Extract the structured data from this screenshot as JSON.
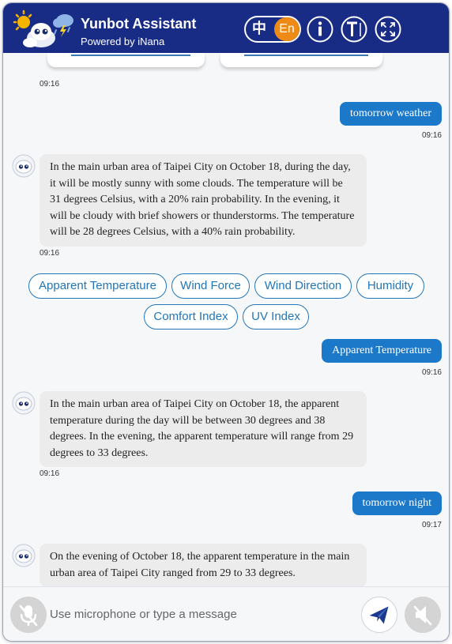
{
  "header": {
    "title": "Yunbot Assistant",
    "subtitle": "Powered by iNana",
    "lang_zh": "中",
    "lang_en": "En",
    "icons": [
      "info-icon",
      "text-size-icon",
      "fullscreen-icon"
    ]
  },
  "colors": {
    "header_bg": "#182c86",
    "accent": "#1c79c9",
    "lang_active": "#ee8a16",
    "bot_bubble": "#ececec"
  },
  "messages": [
    {
      "type": "bot",
      "time": "09:16"
    },
    {
      "type": "user",
      "text": "tomorrow weather",
      "time": "09:16"
    },
    {
      "type": "bot",
      "text": "In the main urban area of Taipei City on October 18, during the day, it will be mostly sunny with some clouds. The temperature will be 31 degrees Celsius, with a 20% rain probability. In the evening, it will be cloudy with brief showers or thunderstorms. The temperature will be 28 degrees Celsius, with a 40% rain probability.",
      "time": "09:16"
    },
    {
      "type": "user",
      "text": "Apparent Temperature",
      "time": "09:16"
    },
    {
      "type": "bot",
      "text": "In the main urban area of Taipei City on October 18, the apparent temperature during the day will be between 30 degrees and 38 degrees. In the evening, the apparent temperature will range from 29 degrees to 33 degrees.",
      "time": "09:16"
    },
    {
      "type": "user",
      "text": "tomorrow night",
      "time": "09:17"
    },
    {
      "type": "bot",
      "text": "On the evening of October 18, the apparent temperature in the main urban area of Taipei City ranged from 29 to 33 degrees."
    }
  ],
  "quick_replies": [
    "Apparent Temperature",
    "Wind Force",
    "Wind Direction",
    "Humidity",
    "Comfort Index",
    "UV Index"
  ],
  "input": {
    "placeholder": "Use microphone or type a message",
    "icons": [
      "microphone-off-icon",
      "send-icon",
      "speaker-muted-icon"
    ]
  }
}
